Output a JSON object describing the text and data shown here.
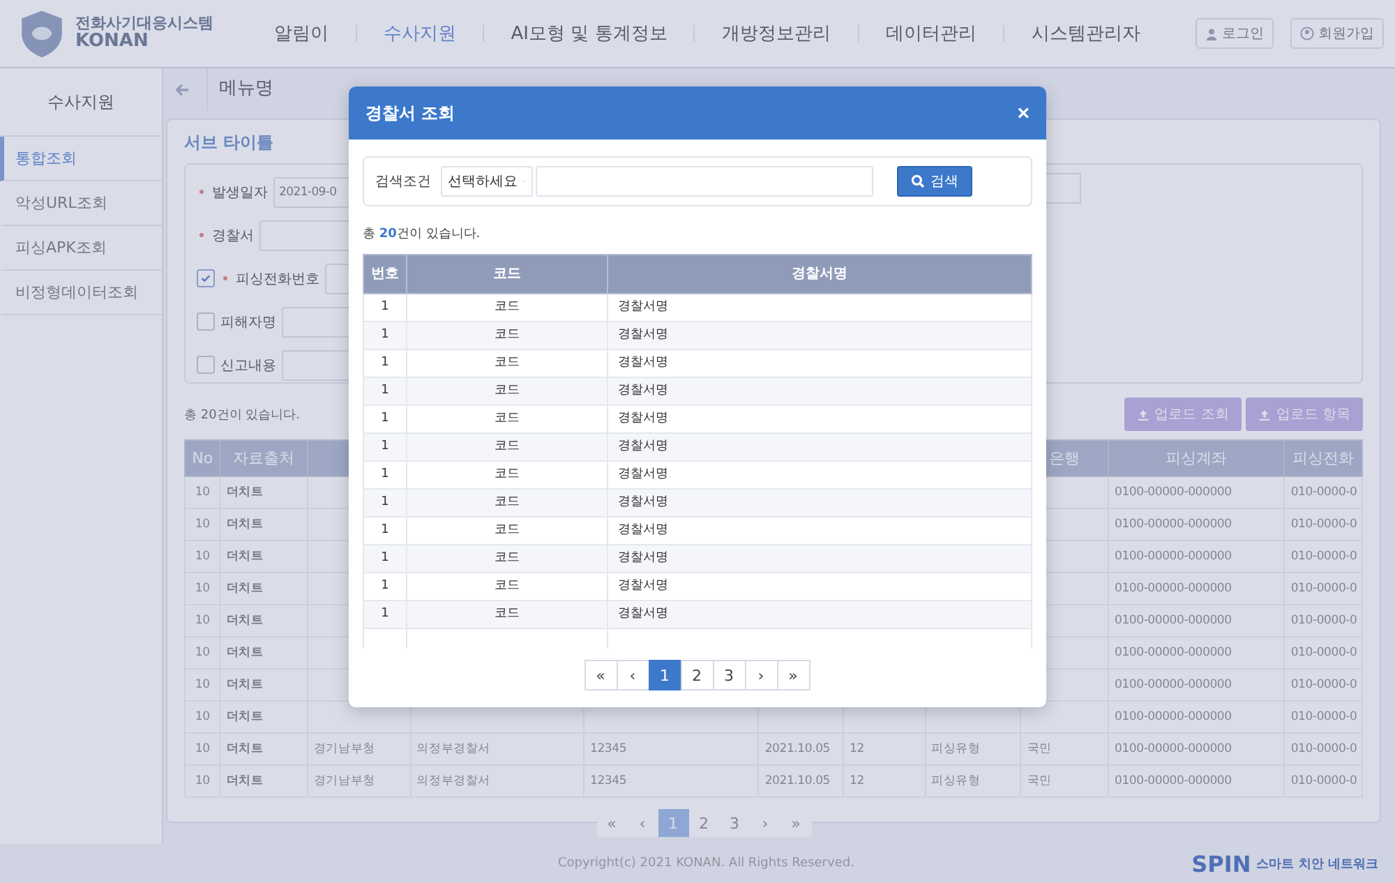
{
  "header": {
    "logo_title": "전화사기대응시스템",
    "logo_name": "KONAN",
    "nav": [
      {
        "label": "알림이",
        "selected": false
      },
      {
        "label": "수사지원",
        "selected": true
      },
      {
        "label": "AI모형 및 통계정보",
        "selected": false
      },
      {
        "label": "개방정보관리",
        "selected": false
      },
      {
        "label": "데이터관리",
        "selected": false
      },
      {
        "label": "시스템관리자",
        "selected": false
      }
    ],
    "login": "로그인",
    "signup": "회원가입"
  },
  "sidebar": {
    "title": "수사지원",
    "items": [
      {
        "label": "통합조회",
        "selected": true
      },
      {
        "label": "악성URL조회",
        "selected": false
      },
      {
        "label": "피싱APK조회",
        "selected": false
      },
      {
        "label": "비정형데이터조회",
        "selected": false
      }
    ]
  },
  "page_title": "메뉴명",
  "sub_title": "서브 타이틀",
  "form": [
    {
      "kind": "plain",
      "label": "발생일자",
      "required": true,
      "value": "2021-09-0"
    },
    {
      "kind": "plain",
      "label": "경찰서",
      "required": true
    },
    {
      "kind": "check",
      "label": "피싱전화번호",
      "required": true,
      "checked": true
    },
    {
      "kind": "check",
      "label": "피해자명",
      "required": false,
      "checked": false
    },
    {
      "kind": "check",
      "label": "신고내용",
      "required": false,
      "checked": false
    }
  ],
  "result_count": "총 20건이 있습니다.",
  "upload_buttons": [
    "업로드 조회",
    "업로드 항목"
  ],
  "table": {
    "columns": [
      "No",
      "자료출처",
      null,
      null,
      null,
      null,
      null,
      null,
      "은행",
      "피싱계좌",
      "피싱전화"
    ],
    "rows": [
      {
        "cells": [
          "10",
          "더치트",
          null,
          null,
          null,
          null,
          null,
          null,
          null,
          "0100-00000-000000",
          "010-0000-0"
        ]
      },
      {
        "cells": [
          "10",
          "더치트",
          null,
          null,
          null,
          null,
          null,
          null,
          null,
          "0100-00000-000000",
          "010-0000-0"
        ]
      },
      {
        "cells": [
          "10",
          "더치트",
          null,
          null,
          null,
          null,
          null,
          null,
          null,
          "0100-00000-000000",
          "010-0000-0"
        ]
      },
      {
        "cells": [
          "10",
          "더치트",
          null,
          null,
          null,
          null,
          null,
          null,
          null,
          "0100-00000-000000",
          "010-0000-0"
        ]
      },
      {
        "cells": [
          "10",
          "더치트",
          null,
          null,
          null,
          null,
          null,
          null,
          null,
          "0100-00000-000000",
          "010-0000-0"
        ]
      },
      {
        "cells": [
          "10",
          "더치트",
          null,
          null,
          null,
          null,
          null,
          null,
          null,
          "0100-00000-000000",
          "010-0000-0"
        ]
      },
      {
        "cells": [
          "10",
          "더치트",
          null,
          null,
          null,
          null,
          null,
          null,
          null,
          "0100-00000-000000",
          "010-0000-0"
        ]
      },
      {
        "cells": [
          "10",
          "더치트",
          null,
          null,
          null,
          null,
          null,
          null,
          null,
          "0100-00000-000000",
          "010-0000-0"
        ]
      },
      {
        "cells": [
          "10",
          "더치트",
          "경기남부청",
          "의정부경찰서",
          "12345",
          "2021.10.05",
          "12",
          "피싱유형",
          "국민",
          "0100-00000-000000",
          "010-0000-0"
        ]
      },
      {
        "cells": [
          "10",
          "더치트",
          "경기남부청",
          "의정부경찰서",
          "12345",
          "2021.10.05",
          "12",
          "피싱유형",
          "국민",
          "0100-00000-000000",
          "010-0000-0"
        ]
      }
    ]
  },
  "pagination": [
    {
      "label": "«",
      "selected": false
    },
    {
      "label": "‹",
      "selected": false
    },
    {
      "label": "1",
      "selected": true
    },
    {
      "label": "2",
      "selected": false
    },
    {
      "label": "3",
      "selected": false
    },
    {
      "label": "›",
      "selected": false
    },
    {
      "label": "»",
      "selected": false
    }
  ],
  "footer": {
    "copyright": "Copyright(c) 2021 KONAN. All Rights Reserved.",
    "brand": "SPIN",
    "brand_sub": "스마트 치안 네트워크"
  },
  "modal": {
    "title": "경찰서 조회",
    "close": "×",
    "search_label": "검색조건",
    "select_value": "선택하세요",
    "search_button": "검색",
    "count": "총 **20**건이 있습니다.",
    "columns": [
      "번호",
      "코드",
      "경찰서명"
    ],
    "rows": [
      [
        "1",
        "코드",
        "경찰서명"
      ],
      [
        "1",
        "코드",
        "경찰서명"
      ],
      [
        "1",
        "코드",
        "경찰서명"
      ],
      [
        "1",
        "코드",
        "경찰서명"
      ],
      [
        "1",
        "코드",
        "경찰서명"
      ],
      [
        "1",
        "코드",
        "경찰서명"
      ],
      [
        "1",
        "코드",
        "경찰서명"
      ],
      [
        "1",
        "코드",
        "경찰서명"
      ],
      [
        "1",
        "코드",
        "경찰서명"
      ],
      [
        "1",
        "코드",
        "경찰서명"
      ],
      [
        "1",
        "코드",
        "경찰서명"
      ],
      [
        "1",
        "코드",
        "경찰서명"
      ]
    ],
    "pagination": [
      {
        "label": "«",
        "selected": false
      },
      {
        "label": "‹",
        "selected": false
      },
      {
        "label": "1",
        "selected": true
      },
      {
        "label": "2",
        "selected": false
      },
      {
        "label": "3",
        "selected": false
      },
      {
        "label": "›",
        "selected": false
      },
      {
        "label": "»",
        "selected": false
      }
    ]
  }
}
